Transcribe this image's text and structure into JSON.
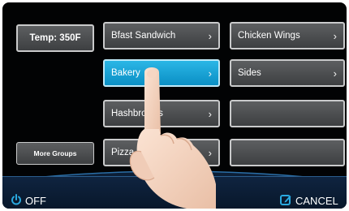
{
  "left_panel": {
    "temp_label": "Temp: 350F",
    "more_groups_label": "More Groups"
  },
  "grid": {
    "col1": [
      {
        "label": "Bfast Sandwich",
        "chevron": "›",
        "active": false
      },
      {
        "label": "Bakery",
        "chevron": "›",
        "active": true
      },
      {
        "label": "Hashbrowns",
        "chevron": "›",
        "active": false
      },
      {
        "label": "Pizza",
        "chevron": "›",
        "active": false
      }
    ],
    "col2": [
      {
        "label": "Chicken Wings",
        "chevron": "›"
      },
      {
        "label": "Sides",
        "chevron": "›"
      },
      {
        "label": ""
      },
      {
        "label": ""
      }
    ]
  },
  "footer": {
    "off_label": "OFF",
    "cancel_label": "CANCEL",
    "power_icon": "power-icon",
    "cancel_icon": "edit-icon",
    "accent": "#2aa9e0"
  },
  "colors": {
    "active_button": "#17a4d8",
    "button": "#4d4f51",
    "background": "#020304"
  }
}
